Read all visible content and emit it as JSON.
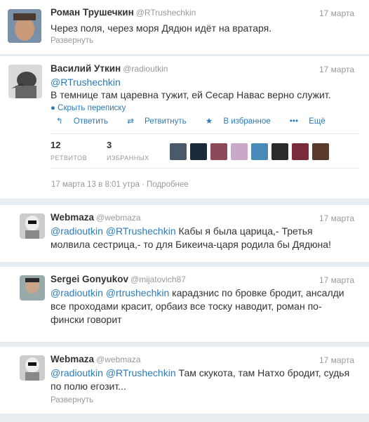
{
  "tweets": [
    {
      "name": "Роман Трушечкин",
      "handle": "@RTrushechkin",
      "date": "17 марта",
      "text": "Через поля, через моря Дядюн идёт на вратаря.",
      "expand": "Развернуть"
    },
    {
      "name": "Василий Уткин",
      "handle": "@radioutkin",
      "date": "17 марта",
      "mention": "@RTrushechkin",
      "text": "В темнице там царевна тужит, ей Сесар Навас верно служит.",
      "hide_conv": "Скрыть переписку",
      "actions": {
        "reply": "Ответить",
        "retweet": "Ретвитнуть",
        "favorite": "В избранное",
        "more": "Ещё"
      },
      "stats": {
        "retweets_num": "12",
        "retweets_label": "РЕТВИТОВ",
        "favs_num": "3",
        "favs_label": "ИЗБРАННЫХ"
      },
      "timestamp": "17 марта 13 в 8:01 утра · Подробнее"
    },
    {
      "name": "Webmaza",
      "handle": "@webmaza",
      "date": "17 марта",
      "m1": "@radioutkin",
      "m2": "@RTrushechkin",
      "text1": "Кабы я была царица,- Третья",
      "text2": "молвила сестрица,- то для Бикеича-царя родила бы Дядюна!"
    },
    {
      "name": "Sergei Gonyukov",
      "handle": "@mijatovich87",
      "date": "17 марта",
      "m1": "@radioutkin",
      "m2": "@rtrushechkin",
      "text1": "карадзнис по бровке бродит, ансалди",
      "text2": "все проходами красит, орбаиз все тоску наводит, роман по-",
      "text3": "фински говорит"
    },
    {
      "name": "Webmaza",
      "handle": "@webmaza",
      "date": "17 марта",
      "m1": "@radioutkin",
      "m2": "@RTrushechkin",
      "text1": "Там скукота, там Натхо бродит, судья",
      "text2": "по полю егозит...",
      "expand": "Развернуть"
    }
  ]
}
